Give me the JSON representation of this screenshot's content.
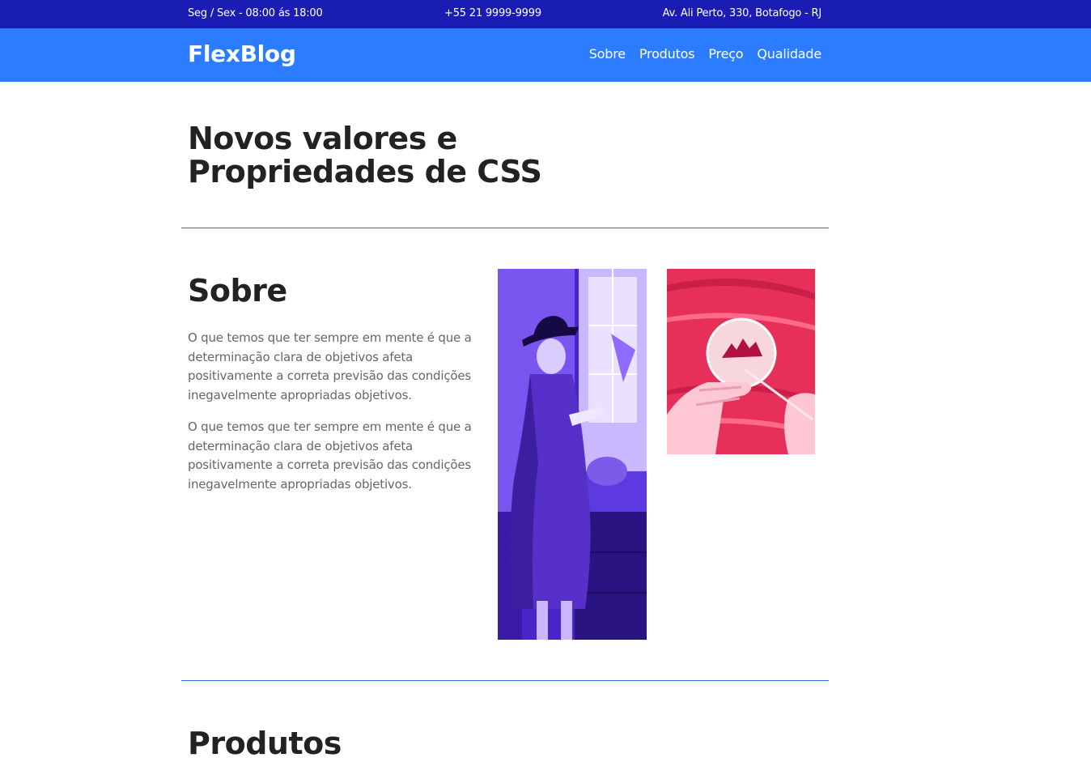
{
  "topbar": {
    "hours": "Seg / Sex - 08:00 ás 18:00",
    "phone": "+55 21 9999-9999",
    "address": "Av. Ali Perto, 330, Botafogo - RJ"
  },
  "header": {
    "logo": "FlexBlog",
    "nav": [
      "Sobre",
      "Produtos",
      "Preço",
      "Qualidade"
    ]
  },
  "hero": {
    "title_line1": "Novos valores e",
    "title_line2": "Propriedades de CSS"
  },
  "sobre": {
    "title": "Sobre",
    "paragraphs": [
      "O que temos que ter sempre em mente é que a determinação clara de objetivos afeta positivamente a correta previsão das condições inegavelmente apropriadas objetivos.",
      "O que temos que ter sempre em mente é que a determinação clara de objetivos afeta positivamente a correta previsão das condições inegavelmente apropriadas objetivos."
    ]
  },
  "produtos": {
    "title": "Produtos"
  },
  "colors": {
    "topbar": "#1a1db3",
    "header": "#2b7cff",
    "divider": "#2b6fd6",
    "photo_woman_tint": "#5b2fe0",
    "photo_hands_tint": "#e8305a"
  }
}
